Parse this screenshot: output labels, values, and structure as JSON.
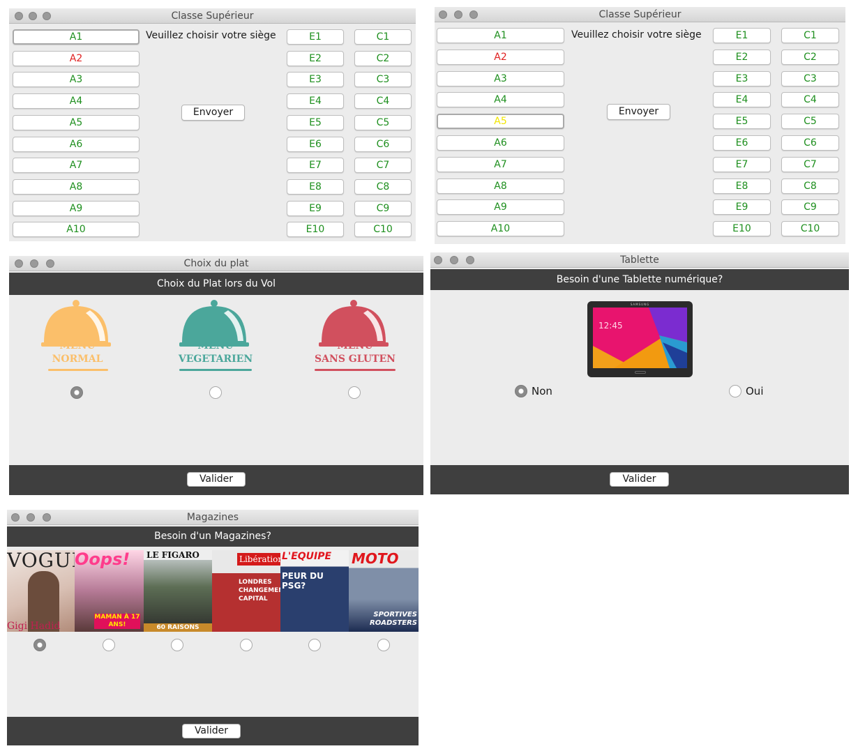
{
  "seat_window_1": {
    "title": "Classe Supérieur",
    "prompt": "Veuillez choisir votre siège",
    "send_label": "Envoyer",
    "col_a": [
      "A1",
      "A2",
      "A3",
      "A4",
      "A5",
      "A6",
      "A7",
      "A8",
      "A9",
      "A10"
    ],
    "col_e": [
      "E1",
      "E2",
      "E3",
      "E4",
      "E5",
      "E6",
      "E7",
      "E8",
      "E9",
      "E10"
    ],
    "col_c": [
      "C1",
      "C2",
      "C3",
      "C4",
      "C5",
      "C6",
      "C7",
      "C8",
      "C9",
      "C10"
    ]
  },
  "seat_window_2": {
    "title": "Classe Supérieur",
    "prompt": "Veuillez choisir votre siège",
    "send_label": "Envoyer",
    "col_a": [
      "A1",
      "A2",
      "A3",
      "A4",
      "A5",
      "A6",
      "A7",
      "A8",
      "A9",
      "A10"
    ],
    "col_e": [
      "E1",
      "E2",
      "E3",
      "E4",
      "E5",
      "E6",
      "E7",
      "E8",
      "E9",
      "E10"
    ],
    "col_c": [
      "C1",
      "C2",
      "C3",
      "C4",
      "C5",
      "C6",
      "C7",
      "C8",
      "C9",
      "C10"
    ]
  },
  "colors": {
    "seat_available": "#1e8f1e",
    "seat_taken": "#e02020",
    "seat_selected": "#f2e600",
    "menu_normal": "#fbbf6a",
    "menu_vegetarien": "#4ba79b",
    "menu_sans_gluten": "#d1505e",
    "dark_bar": "#3f3f3f"
  },
  "plat_window": {
    "title": "Choix du plat",
    "header": "Choix du Plat lors du Vol",
    "options": [
      {
        "line1": "MENU",
        "line2": "NORMAL",
        "selected": true
      },
      {
        "line1": "MENU",
        "line2": "VEGETARIEN",
        "selected": false
      },
      {
        "line1": "MENU",
        "line2": "SANS GLUTEN",
        "selected": false
      }
    ],
    "validate_label": "Valider"
  },
  "tablette_window": {
    "title": "Tablette",
    "header": "Besoin d'une Tablette numérique?",
    "screen_time": "12:45",
    "brand": "SAMSUNG",
    "option_no": "Non",
    "option_yes": "Oui",
    "validate_label": "Valider"
  },
  "magazines_window": {
    "title": "Magazines",
    "header": "Besoin d'un Magazines?",
    "covers": [
      {
        "masthead": "VOGUE",
        "tagline": "Gigi Hadid",
        "selected": true
      },
      {
        "masthead": "Oops!",
        "tagline": "MAMAN À 17 ANS!",
        "selected": false
      },
      {
        "masthead": "LE FIGARO",
        "tagline": "60 RAISONS",
        "selected": false
      },
      {
        "masthead": "Libération",
        "tagline": "LONDRES CHANGEMENT CAPITAL",
        "selected": false
      },
      {
        "masthead": "L'EQUIPE",
        "tagline": "PEUR DU PSG?",
        "selected": false
      },
      {
        "masthead": "MOTO",
        "tagline": "SPORTIVES ROADSTERS",
        "selected": false
      }
    ],
    "validate_label": "Valider"
  }
}
